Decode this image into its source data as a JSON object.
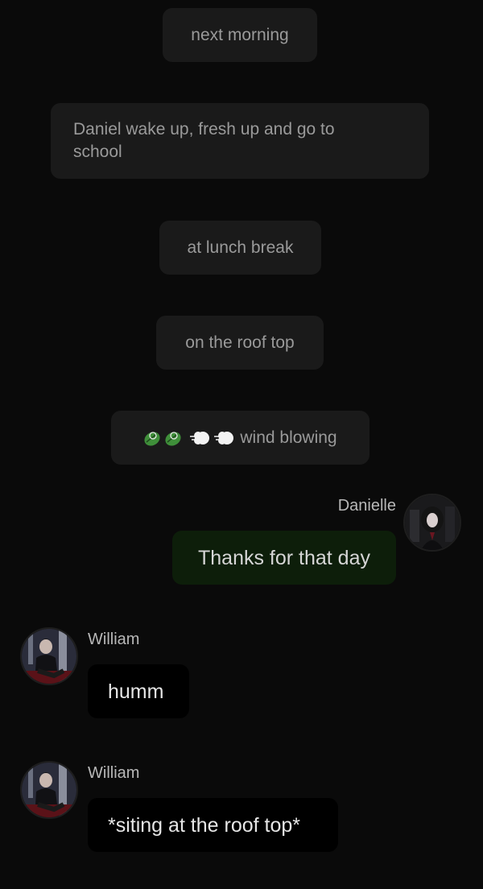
{
  "narrations": [
    {
      "text": "next morning"
    },
    {
      "text": "Daniel wake up, fresh up and go to school"
    },
    {
      "text": "at lunch break"
    },
    {
      "text": "on the roof top"
    },
    {
      "text": "wind blowing",
      "icons": [
        "leaf-icon",
        "leaf-icon",
        "wind-puff-icon",
        "wind-puff-icon"
      ]
    }
  ],
  "messages": [
    {
      "sender": "Danielle",
      "text": "Thanks for that day",
      "side": "right"
    },
    {
      "sender": "William",
      "text": "humm",
      "side": "left"
    },
    {
      "sender": "William",
      "text": "*siting at the roof top*",
      "side": "left"
    }
  ],
  "colors": {
    "background": "#0a0a0a",
    "narration_bg": "#1a1a1a",
    "narration_text": "#9a9a9a",
    "user_bubble_bg": "#0d1e0a",
    "char_bubble_bg": "#000000",
    "leaf_green": "#3f8f3a"
  }
}
